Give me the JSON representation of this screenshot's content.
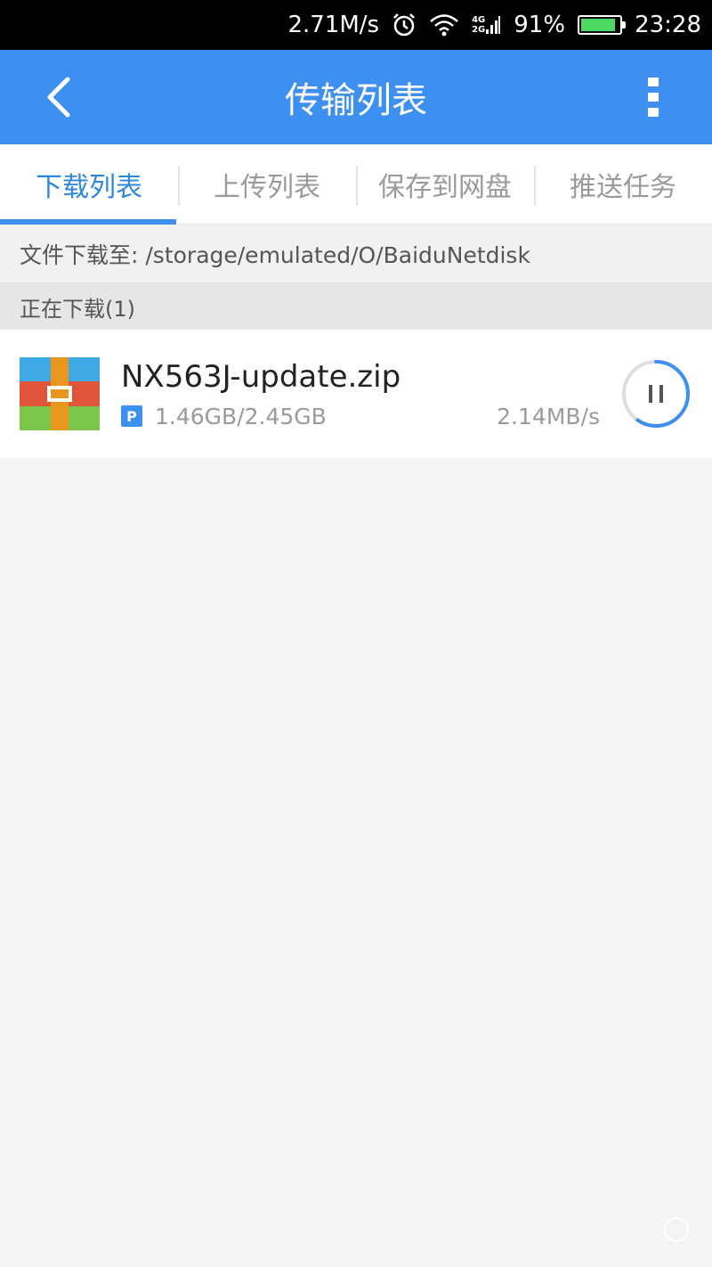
{
  "status_bar": {
    "net_speed": "2.71M/s",
    "net_4g": "4G",
    "net_2g": "2G",
    "battery": "91%",
    "battery_level": 0.91,
    "time": "23:28",
    "icons": [
      "alarm-icon",
      "wifi-icon",
      "signal-icon",
      "battery-icon"
    ]
  },
  "app_bar": {
    "title": "传输列表",
    "icons": [
      "back-arrow-icon",
      "more-vertical-icon"
    ]
  },
  "tabs": [
    {
      "label": "下载列表",
      "active": true
    },
    {
      "label": "上传列表",
      "active": false
    },
    {
      "label": "保存到网盘",
      "active": false
    },
    {
      "label": "推送任务",
      "active": false
    }
  ],
  "path_bar": {
    "text": "文件下载至: /storage/emulated/O/BaiduNetdisk"
  },
  "section": {
    "header": "正在下载(1)"
  },
  "downloads": [
    {
      "icon": "zip-archive-icon",
      "name": "NX563J-update.zip",
      "badge": "P",
      "size": "1.46GB/2.45GB",
      "speed": "2.14MB/s",
      "progress": 0.596
    }
  ],
  "colors": {
    "accent": "#3d8ff0",
    "tab_active": "#2f87d9"
  }
}
